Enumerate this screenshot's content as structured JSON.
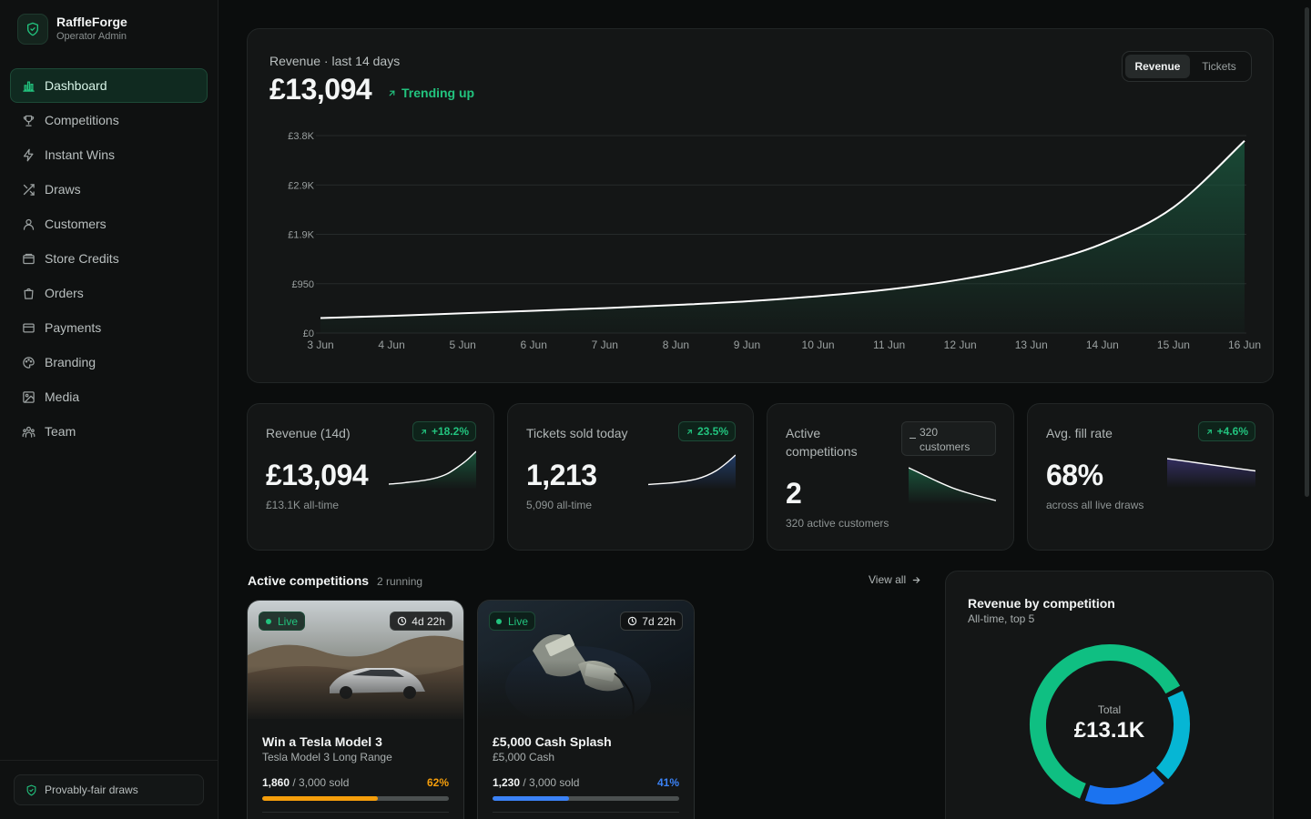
{
  "brand": {
    "name": "RaffleForge",
    "subtitle": "Operator Admin"
  },
  "sidebar": {
    "items": [
      {
        "label": "Dashboard",
        "icon": "bar-chart-icon",
        "active": true
      },
      {
        "label": "Competitions",
        "icon": "trophy-icon"
      },
      {
        "label": "Instant Wins",
        "icon": "lightning-icon"
      },
      {
        "label": "Draws",
        "icon": "shuffle-icon"
      },
      {
        "label": "Customers",
        "icon": "user-icon"
      },
      {
        "label": "Store Credits",
        "icon": "wallet-icon"
      },
      {
        "label": "Orders",
        "icon": "shopping-bag-icon"
      },
      {
        "label": "Payments",
        "icon": "credit-card-icon"
      },
      {
        "label": "Branding",
        "icon": "palette-icon"
      },
      {
        "label": "Media",
        "icon": "image-icon"
      },
      {
        "label": "Team",
        "icon": "team-icon"
      }
    ],
    "footer_label": "Provably-fair draws"
  },
  "revenue_chart": {
    "title": "Revenue · last 14 days",
    "value": "£13,094",
    "trend": "Trending up",
    "toggle": {
      "revenue": "Revenue",
      "tickets": "Tickets",
      "selected": "Revenue"
    }
  },
  "chart_data": {
    "type": "area",
    "x": [
      "3 Jun",
      "4 Jun",
      "5 Jun",
      "6 Jun",
      "7 Jun",
      "8 Jun",
      "9 Jun",
      "10 Jun",
      "11 Jun",
      "12 Jun",
      "13 Jun",
      "14 Jun",
      "15 Jun",
      "16 Jun"
    ],
    "series": [
      {
        "values": [
          290,
          330,
          380,
          430,
          480,
          540,
          610,
          710,
          840,
          1030,
          1300,
          1720,
          2420,
          3700
        ]
      }
    ],
    "yticks": [
      "£0",
      "£950",
      "£1.9K",
      "£2.9K",
      "£3.8K"
    ],
    "ylim": [
      0,
      3800
    ],
    "grid": true,
    "colors": {
      "line": "#ffffff",
      "fill": "#1a5a40"
    }
  },
  "stats": [
    {
      "label": "Revenue (14d)",
      "value": "£13,094",
      "sub": "£13.1K all-time",
      "badge": "+18.2%",
      "spark": [
        0.1,
        0.12,
        0.15,
        0.18,
        0.22,
        0.28,
        0.38,
        0.55,
        0.75,
        1.0
      ],
      "spark_color": "#22c37e"
    },
    {
      "label": "Tickets sold today",
      "value": "1,213",
      "sub": "5,090 all-time",
      "badge": "23.5%",
      "spark": [
        0.1,
        0.12,
        0.14,
        0.17,
        0.21,
        0.27,
        0.37,
        0.52,
        0.74,
        1.0
      ],
      "spark_color": "#3b82f6"
    },
    {
      "label": "Active competitions",
      "value": "2",
      "sub": "320 active customers",
      "badge": "320 customers",
      "spark": [
        1.0,
        0.8,
        0.6,
        0.42,
        0.28,
        0.16,
        0.05
      ],
      "spark_color": "#22c37e"
    },
    {
      "label": "Avg. fill rate",
      "value": "68%",
      "sub": "across all live draws",
      "badge": "+4.6%",
      "spark": [
        1.0,
        0.85,
        0.7,
        0.55
      ],
      "spark_color": "#6d5ce8"
    }
  ],
  "active_competitions": {
    "title": "Active competitions",
    "count": "2 running",
    "view_all": "View all",
    "items": [
      {
        "status": "Live",
        "timer": "4d 22h",
        "name": "Win a Tesla Model 3",
        "prize": "Tesla Model 3 Long Range",
        "sold": "1,860",
        "total": "/ 3,000 sold",
        "percent": "62%",
        "fill": 0.62,
        "color": "#f59e0b"
      },
      {
        "status": "Live",
        "timer": "7d 22h",
        "name": "£5,000 Cash Splash",
        "prize": "£5,000 Cash",
        "sold": "1,230",
        "total": "/ 3,000 sold",
        "percent": "41%",
        "fill": 0.41,
        "color": "#3b82f6"
      }
    ]
  },
  "revenue_by_competition": {
    "title": "Revenue by competition",
    "subtitle": "All-time, top 5",
    "total_label": "Total",
    "total_value": "£13.1K",
    "slices": [
      {
        "value": 0.62,
        "color": "#0fbf82"
      },
      {
        "value": 0.18,
        "color": "#1b73f0"
      },
      {
        "value": 0.2,
        "color": "#06b6d4"
      }
    ]
  }
}
